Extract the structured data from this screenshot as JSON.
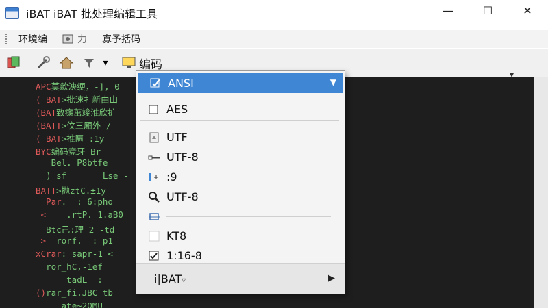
{
  "window": {
    "title": "iBAT iBAT 批处理编辑工具",
    "minimize_glyph": "—",
    "maximize_glyph": "☐",
    "close_glyph": "✕"
  },
  "menubar": {
    "items": [
      {
        "label": "环境编",
        "icon": "gear-icon"
      },
      {
        "label": "力",
        "icon": "picture-icon"
      },
      {
        "label": "寡予括码",
        "icon": ""
      }
    ]
  },
  "toolbar": {
    "encode_label": "编码",
    "dropdown_caret": "▾"
  },
  "encoding_menu": {
    "selected": "ANSI",
    "items": [
      {
        "label": "AES",
        "icon": "checkbox-icon"
      },
      {
        "label": "UTF",
        "icon": "document-icon"
      },
      {
        "label": "UTF-8",
        "icon": "key-icon"
      },
      {
        "label": ":9",
        "icon": "cursor-plus-icon"
      },
      {
        "label": "UTF-8",
        "icon": "search-icon"
      },
      {
        "label": "KT8",
        "icon": "blank-box-icon"
      },
      {
        "label": "1:16-8",
        "icon": "checked-box-icon"
      }
    ],
    "footer_label": "i|BAT",
    "footer_glyph": "▿",
    "submenu_arrow": "▶"
  },
  "editor": {
    "lines": [
      {
        "prefix": "APC",
        "text": "莫歙泱绠，-], 0"
      },
      {
        "prefix": "( BAT",
        "text": ">批速扌新由山"
      },
      {
        "prefix": "(BAT",
        "text": "致癍茁竣淮欣扩"
      },
      {
        "prefix": "(BATT",
        "text": ">伩三厢外 /"
      },
      {
        "prefix": "( BAT",
        "text": ">推匾 :1y"
      },
      {
        "prefix": "BYC",
        "text": "编码竟牙 Br"
      },
      {
        "prefix": "   ",
        "text": "Bel. P8btfe"
      },
      {
        "prefix": "  ",
        "text": ") sf       Lse -"
      },
      {
        "prefix": "BATT",
        "text": ">抛ztC.±1y"
      },
      {
        "prefix": "  Par",
        "text": ".  : 6:pho"
      },
      {
        "prefix": " <  ",
        "text": "  .rtP. 1.aB0"
      },
      {
        "prefix": "  ",
        "text": "Btc己:理 2 -td"
      },
      {
        "prefix": " > ",
        "text": " rorf.  : p1"
      },
      {
        "prefix": "xCrar",
        "text": ": sapr-1 <"
      },
      {
        "prefix": "  ",
        "text": "ror_hC,-1ef"
      },
      {
        "prefix": "      ",
        "text": "tadL  :"
      },
      {
        "prefix": "()",
        "text": "rar_fi.JBC tb"
      },
      {
        "prefix": "     ",
        "text": "ate~2OMU"
      }
    ]
  },
  "colors": {
    "accent": "#3f86d4",
    "editor_bg": "#1e1e1e",
    "code_green": "#78c878",
    "code_red": "#e05a5a"
  }
}
